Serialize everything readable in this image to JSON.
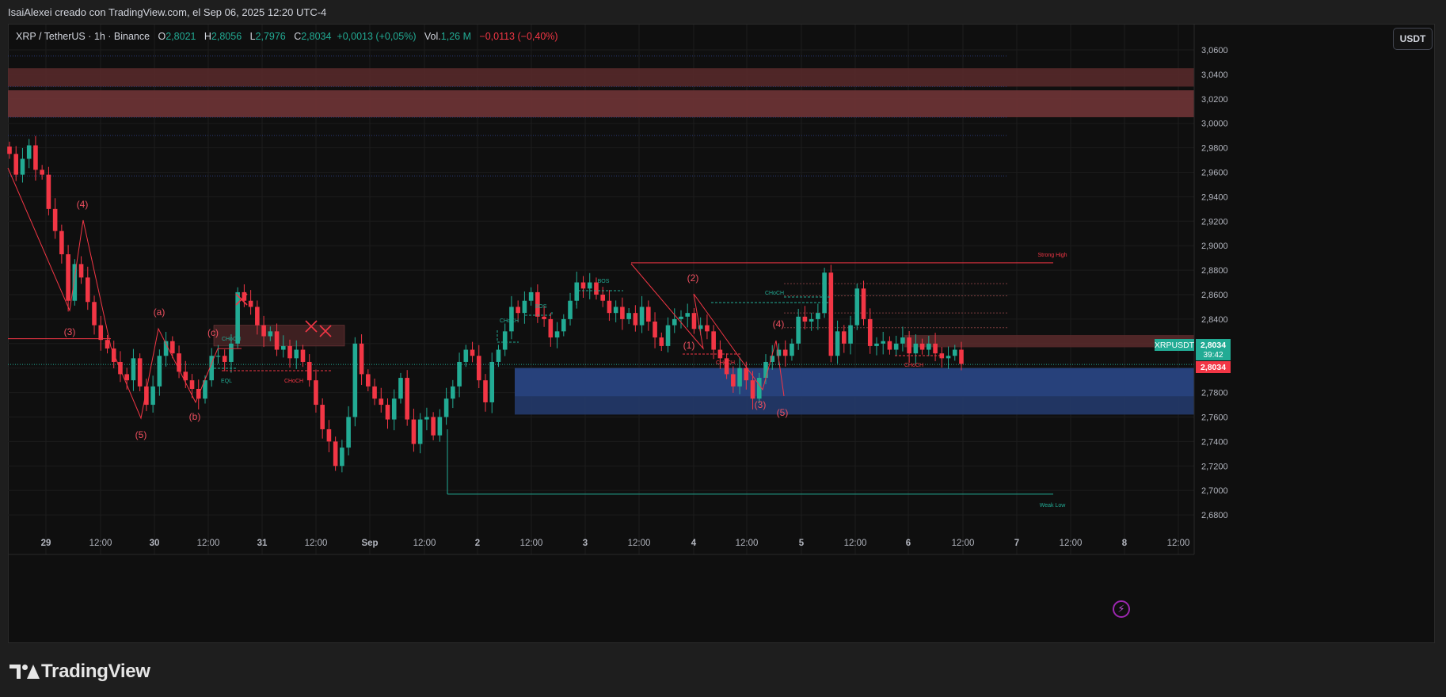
{
  "header": {
    "caption": "IsaiAlexei creado con TradingView.com, el Sep 06, 2025 12:20 UTC-4"
  },
  "legend": {
    "symbol": "XRP / TetherUS · 1h · Binance",
    "o_label": "O",
    "o_value": "2,8021",
    "h_label": "H",
    "h_value": "2,8056",
    "l_label": "L",
    "l_value": "2,7976",
    "c_label": "C",
    "c_value": "2,8034",
    "change": "+0,0013 (+0,05%)",
    "vol_label": "Vol.",
    "vol_value": "1,26 M",
    "vol_change": "−0,0113 (−0,40%)"
  },
  "currency_button": "USDT",
  "brand": "TradingView",
  "colors": {
    "up": "#22ab94",
    "down": "#f23645",
    "supply": "#b2444a",
    "demand": "#2a4a8a",
    "background": "#0f0f0f"
  },
  "chart_data": {
    "type": "candlestick",
    "interval": "1h",
    "ylim": [
      2.67,
      3.07
    ],
    "y_ticks": [
      "3,0600",
      "3,0400",
      "3,0200",
      "3,0000",
      "2,9800",
      "2,9600",
      "2,9400",
      "2,9200",
      "2,9000",
      "2,8800",
      "2,8600",
      "2,8400",
      "2,8200",
      "2,8000",
      "2,7800",
      "2,7600",
      "2,7400",
      "2,7200",
      "2,7000",
      "2,6800"
    ],
    "y_tick_values": [
      3.06,
      3.04,
      3.02,
      3.0,
      2.98,
      2.96,
      2.94,
      2.92,
      2.9,
      2.88,
      2.86,
      2.84,
      2.82,
      2.8,
      2.78,
      2.76,
      2.74,
      2.72,
      2.7,
      2.68
    ],
    "x_ticks": [
      "29",
      "12:00",
      "30",
      "12:00",
      "31",
      "12:00",
      "Sep",
      "12:00",
      "2",
      "12:00",
      "3",
      "12:00",
      "4",
      "12:00",
      "5",
      "12:00",
      "6",
      "12:00",
      "7",
      "12:00",
      "8",
      "12:00"
    ],
    "price_labels": {
      "symbol": "XRPUSDT",
      "last": "2,8034",
      "countdown": "39:42",
      "close": "2,8034"
    },
    "close_path": [
      2.975,
      2.958,
      2.971,
      2.982,
      2.962,
      2.958,
      2.93,
      2.912,
      2.893,
      2.855,
      2.885,
      2.874,
      2.854,
      2.835,
      2.823,
      2.816,
      2.805,
      2.795,
      2.79,
      2.808,
      2.785,
      2.77,
      2.785,
      2.81,
      2.822,
      2.812,
      2.797,
      2.79,
      2.783,
      2.775,
      2.79,
      2.81,
      2.81,
      2.805,
      2.82,
      2.862,
      2.855,
      2.85,
      2.835,
      2.826,
      2.83,
      2.815,
      2.818,
      2.808,
      2.815,
      2.805,
      2.79,
      2.77,
      2.75,
      2.74,
      2.72,
      2.735,
      2.76,
      2.82,
      2.795,
      2.785,
      2.775,
      2.77,
      2.758,
      2.775,
      2.792,
      2.758,
      2.738,
      2.758,
      2.76,
      2.745,
      2.76,
      2.775,
      2.785,
      2.805,
      2.815,
      2.81,
      2.79,
      2.772,
      2.805,
      2.815,
      2.83,
      2.85,
      2.845,
      2.855,
      2.862,
      2.842,
      2.84,
      2.825,
      2.83,
      2.84,
      2.855,
      2.87,
      2.865,
      2.87,
      2.86,
      2.855,
      2.845,
      2.85,
      2.84,
      2.845,
      2.835,
      2.85,
      2.838,
      2.825,
      2.818,
      2.835,
      2.84,
      2.842,
      2.845,
      2.832,
      2.835,
      2.83,
      2.815,
      2.808,
      2.795,
      2.785,
      2.8,
      2.79,
      2.775,
      2.792,
      2.805,
      2.81,
      2.815,
      2.81,
      2.82,
      2.842,
      2.838,
      2.84,
      2.845,
      2.878,
      2.81,
      2.83,
      2.82,
      2.835,
      2.865,
      2.84,
      2.818,
      2.82,
      2.822,
      2.815,
      2.82,
      2.825,
      2.812,
      2.82,
      2.815,
      2.82,
      2.812,
      2.808,
      2.81,
      2.815,
      2.8034
    ],
    "annotations": {
      "wave_labels": [
        {
          "text": "(4)",
          "x": "Aug 28 ~19:00",
          "y": 2.932
        },
        {
          "text": "(3)",
          "x": "Aug 28 ~16:00",
          "y": 2.826
        },
        {
          "text": "(5)",
          "x": "Aug 29 ~20:00",
          "y": 2.758
        },
        {
          "text": "(a)",
          "x": "Aug 30 ~00:00",
          "y": 2.843
        },
        {
          "text": "(b)",
          "x": "Aug 30 ~09:00",
          "y": 2.768
        },
        {
          "text": "(c)",
          "x": "Aug 30 ~14:00",
          "y": 2.826
        },
        {
          "text": "(2)",
          "x": "Sep 3 ~22:00",
          "y": 2.872
        },
        {
          "text": "(1)",
          "x": "Sep 3 ~18:00",
          "y": 2.815
        },
        {
          "text": "(4)",
          "x": "Sep 4 ~13:00",
          "y": 2.83
        },
        {
          "text": "(3)",
          "x": "Sep 4 ~10:00",
          "y": 2.776
        },
        {
          "text": "(5)",
          "x": "Sep 4 ~14:00",
          "y": 2.771
        }
      ],
      "structure_labels": [
        "BOS",
        "BOS",
        "CHoCH",
        "CHoCH",
        "CHoCH",
        "CHoCH",
        "CHoCH",
        "CHoCH",
        "EQL"
      ],
      "level_labels": [
        "Strong High",
        "Weak Low"
      ],
      "zones": [
        {
          "kind": "supply",
          "from": 3.027,
          "to": 3.005
        },
        {
          "kind": "supply",
          "from": 3.045,
          "to": 3.03
        },
        {
          "kind": "demand",
          "from": 2.8,
          "to": 2.762
        },
        {
          "kind": "supply",
          "from": 2.827,
          "to": 2.817
        }
      ]
    }
  }
}
